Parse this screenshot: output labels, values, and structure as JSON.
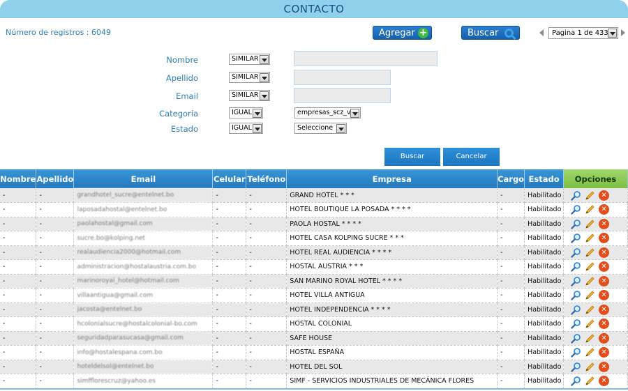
{
  "header": {
    "title": "CONTACTO"
  },
  "toolbar": {
    "count_text": "Número de registros : 6049",
    "agregar_label": "Agregar",
    "buscar_label": "Buscar",
    "page_select": "Pagina 1 de 433"
  },
  "filters": {
    "nombre": {
      "label": "Nombre",
      "operator": "SIMILAR",
      "value": ""
    },
    "apellido": {
      "label": "Apellido",
      "operator": "SIMILAR",
      "value": ""
    },
    "email": {
      "label": "Email",
      "operator": "SIMILAR",
      "value": ""
    },
    "categoria": {
      "label": "Categoria",
      "operator": "IGUAL",
      "value": "empresas_scz_v"
    },
    "estado": {
      "label": "Estado",
      "operator": "IGUAL",
      "value": "Seleccione"
    }
  },
  "actions": {
    "buscar_label": "Buscar",
    "cancelar_label": "Cancelar"
  },
  "table": {
    "columns": [
      "Nombre",
      "Apellido",
      "Email",
      "Celular",
      "Teléfono",
      "Empresa",
      "Cargo",
      "Estado",
      "Opciones"
    ],
    "rows": [
      {
        "nombre": "-",
        "apellido": "-",
        "email": "grandhotel_sucre@entelnet.bo",
        "celular": "-",
        "telefono": "-",
        "empresa": "GRAND HOTEL * * *",
        "cargo": "-",
        "estado": "Habilitado"
      },
      {
        "nombre": "-",
        "apellido": "-",
        "email": "laposadahostal@entelnet.bo",
        "celular": "-",
        "telefono": "-",
        "empresa": "HOTEL BOUTIQUE LA POSADA * * * *",
        "cargo": "-",
        "estado": "Habilitado"
      },
      {
        "nombre": "-",
        "apellido": "-",
        "email": "paolahostal@gmail.com",
        "celular": "-",
        "telefono": "-",
        "empresa": "PAOLA HOSTAL * * * *",
        "cargo": "-",
        "estado": "Habilitado"
      },
      {
        "nombre": "-",
        "apellido": "-",
        "email": "sucre.bo@kolping.net",
        "celular": "-",
        "telefono": "-",
        "empresa": "HOTEL CASA KOLPING SUCRE * * *",
        "cargo": "-",
        "estado": "Habilitado"
      },
      {
        "nombre": "-",
        "apellido": "-",
        "email": "realaudiencia2000@hotmail.com",
        "celular": "-",
        "telefono": "-",
        "empresa": "HOTEL REAL AUDIENCIA * * * *",
        "cargo": "-",
        "estado": "Habilitado"
      },
      {
        "nombre": "-",
        "apellido": "-",
        "email": "administracion@hostalaustria.com.bo",
        "celular": "-",
        "telefono": "-",
        "empresa": "HOSTAL AUSTRIA * * *",
        "cargo": "-",
        "estado": "Habilitado"
      },
      {
        "nombre": "-",
        "apellido": "-",
        "email": "marinoroyal_hotel@hotmail.com",
        "celular": "-",
        "telefono": "-",
        "empresa": "SAN MARINO ROYAL HOTEL * * * *",
        "cargo": "-",
        "estado": "Habilitado"
      },
      {
        "nombre": "-",
        "apellido": "-",
        "email": "villaantigua@gmail.com",
        "celular": "-",
        "telefono": "-",
        "empresa": "HOTEL VILLA ANTIGUA",
        "cargo": "-",
        "estado": "Habilitado"
      },
      {
        "nombre": "-",
        "apellido": "-",
        "email": "jacosta@entelnet.bo",
        "celular": "-",
        "telefono": "-",
        "empresa": "HOTEL INDEPENDENCIA * * * *",
        "cargo": "-",
        "estado": "Habilitado"
      },
      {
        "nombre": "-",
        "apellido": "-",
        "email": "hcolonialsucre@hostalcolonial-bo.com",
        "celular": "-",
        "telefono": "-",
        "empresa": "HOSTAL COLONIAL",
        "cargo": "-",
        "estado": "Habilitado"
      },
      {
        "nombre": "-",
        "apellido": "-",
        "email": "seguridadparasucasa@gmail.com",
        "celular": "-",
        "telefono": "-",
        "empresa": "SAFE HOUSE",
        "cargo": "-",
        "estado": "Habilitado"
      },
      {
        "nombre": "-",
        "apellido": "-",
        "email": "info@hostalespana.com.bo",
        "celular": "-",
        "telefono": "-",
        "empresa": "HOSTAL ESPAÑA",
        "cargo": "-",
        "estado": "Habilitado"
      },
      {
        "nombre": "-",
        "apellido": "-",
        "email": "hoteldelsol@entelnet.bo",
        "celular": "-",
        "telefono": "-",
        "empresa": "HOTEL DEL SOL",
        "cargo": "-",
        "estado": "Habilitado"
      },
      {
        "nombre": "-",
        "apellido": "-",
        "email": "simfflorescruz@yahoo.es",
        "celular": "-",
        "telefono": "-",
        "empresa": "SIMF - SERVICIOS INDUSTRIALES DE MECÁNICA FLORES",
        "cargo": "-",
        "estado": "Habilitado"
      }
    ]
  }
}
